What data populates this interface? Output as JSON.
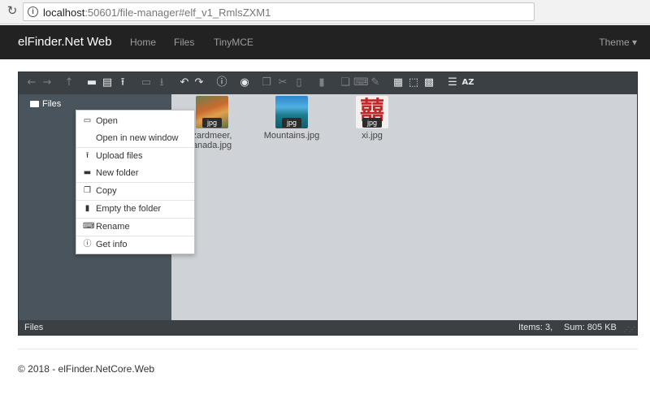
{
  "browser": {
    "url_host": "localhost",
    "url_rest": ":50601/file-manager#elf_v1_RmlsZXM1"
  },
  "navbar": {
    "brand": "elFinder.Net Web",
    "links": [
      "Home",
      "Files",
      "TinyMCE"
    ],
    "theme": "Theme ▾"
  },
  "toolbar": {
    "icons": [
      "back-icon",
      "forward-icon",
      "up-icon",
      "new-folder-icon",
      "new-file-icon",
      "upload-icon",
      "open-icon",
      "download-icon",
      "undo-icon",
      "redo-icon",
      "info-icon",
      "preview-icon",
      "copy-icon",
      "cut-icon",
      "paste-icon",
      "delete-icon",
      "duplicate-icon",
      "rename-icon",
      "edit-icon",
      "select-all-icon",
      "select-none-icon",
      "invert-selection-icon",
      "list-view-icon",
      "sort-icon"
    ]
  },
  "tree": {
    "root": "Files"
  },
  "files": [
    {
      "name_line1": "zardmeer,",
      "name_line2": "anada.jpg",
      "badge": "jpg"
    },
    {
      "name_line1": "Mountains.jpg",
      "name_line2": "",
      "badge": "jpg"
    },
    {
      "name_line1": "xi.jpg",
      "name_line2": "",
      "badge": "jpg",
      "glyph": "囍"
    }
  ],
  "context_menu": {
    "items": [
      {
        "label": "Open",
        "icon": "folder-open-icon"
      },
      {
        "label": "Open in new window",
        "icon": ""
      },
      {
        "label": "Upload files",
        "icon": "upload-icon"
      },
      {
        "label": "New folder",
        "icon": "new-folder-icon"
      },
      {
        "label": "Copy",
        "icon": "copy-icon"
      },
      {
        "label": "Empty the folder",
        "icon": "empty-folder-icon"
      },
      {
        "label": "Rename",
        "icon": "rename-icon"
      },
      {
        "label": "Get info",
        "icon": "info-icon"
      }
    ]
  },
  "statusbar": {
    "path": "Files",
    "items": "Items: 3,",
    "sum": "Sum: 805 KB"
  },
  "footer": {
    "text": "© 2018 - elFinder.NetCore.Web"
  }
}
